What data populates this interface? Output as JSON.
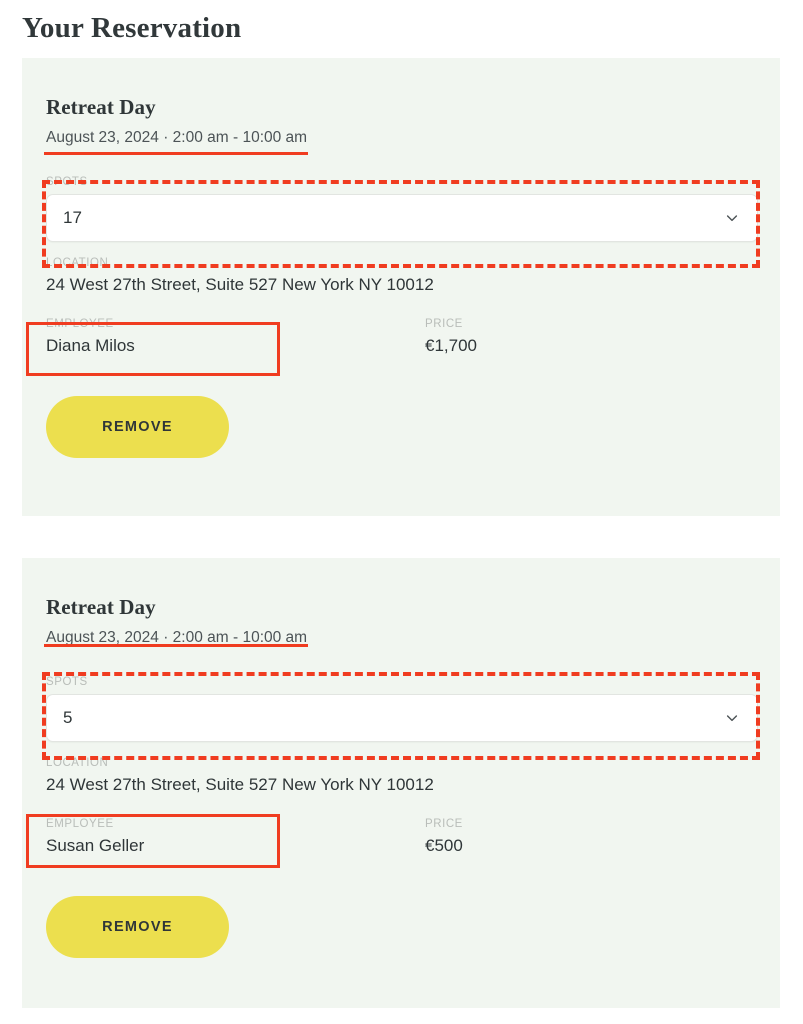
{
  "page": {
    "title": "Your Reservation",
    "background_color": "#ffffff"
  },
  "theme": {
    "card_background": "#f1f6f0",
    "accent_button": "#ecdf4e",
    "annotation_red": "#f03c20",
    "label_gray": "#b9bdb9",
    "text_dark": "#2f3638"
  },
  "reservations": [
    {
      "event_title": "Retreat Day",
      "datetime": "August 23, 2024 · 2:00 am - 10:00 am",
      "spots": {
        "label": "SPOTS",
        "value": "17",
        "icon": "chevron-down-icon"
      },
      "location": {
        "label": "LOCATION",
        "value": "24 West 27th Street, Suite 527 New York NY 10012"
      },
      "employee": {
        "label": "EMPLOYEE",
        "value": "Diana Milos"
      },
      "price": {
        "label": "PRICE",
        "value": "€1,700"
      },
      "remove_label": "REMOVE"
    },
    {
      "event_title": "Retreat Day",
      "datetime": "August 23, 2024 · 2:00 am - 10:00 am",
      "spots": {
        "label": "SPOTS",
        "value": "5",
        "icon": "chevron-down-icon"
      },
      "location": {
        "label": "LOCATION",
        "value": "24 West 27th Street, Suite 527 New York NY 10012"
      },
      "employee": {
        "label": "EMPLOYEE",
        "value": "Susan Geller"
      },
      "price": {
        "label": "PRICE",
        "value": "€500"
      },
      "remove_label": "REMOVE"
    }
  ]
}
